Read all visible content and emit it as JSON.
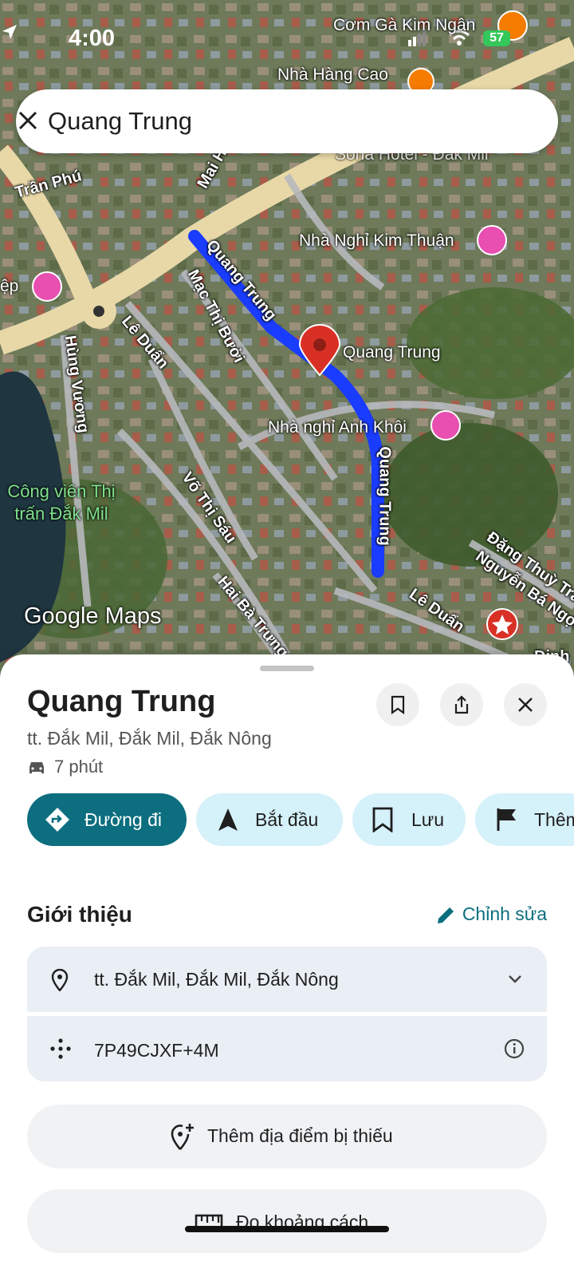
{
  "status_bar": {
    "time": "4:00",
    "battery": "57"
  },
  "search": {
    "value": "Quang Trung"
  },
  "map": {
    "labels": {
      "com_ga": "Cơm Gà Kim Ngân",
      "nha_hang": "Nhà Hàng Cao",
      "sona": "Sona Hotel - Đắk Mil",
      "tran_phu": "Trần Phú",
      "mai": "Mai H",
      "kim_thuan": "Nhà Nghỉ Kim Thuận",
      "ep": "ệp",
      "quang_trung_road": "Quang Trung",
      "mac_thi_buoi": "Mạc Thị Bưởi",
      "le_duan_1": "Lê Duẩn",
      "hung_vuong": "Hùng Vương",
      "pin_label": "Quang Trung",
      "anh_khoi": "Nhà nghỉ Anh Khôi",
      "quang_trung_road_2": "Quang Trung",
      "cong_vien": "Công viên Thị trấn Đắk Mil",
      "vo_thi_sau": "Võ Thị Sáu",
      "dang_thuy_tram": "Đặng Thuỳ Trâ",
      "nguyen_ba_ngoc": "Nguyễn Bá Ngọc",
      "hai_ba_trung": "Hai Bà Trưng",
      "le_duan_2": "Lê Duẩn",
      "dinh": "Đinh",
      "logo": "Google Maps"
    }
  },
  "place": {
    "title": "Quang Trung",
    "address": "tt. Đắk Mil, Đắk Mil, Đắk Nông",
    "eta": "7 phút"
  },
  "actions": {
    "directions": "Đường đi",
    "start": "Bắt đầu",
    "save": "Lưu",
    "more": "Thêm"
  },
  "intro": {
    "title": "Giới thiệu",
    "edit": "Chỉnh sửa",
    "address": "tt. Đắk Mil, Đắk Mil, Đắk Nông",
    "plus_code": "7P49CJXF+4M"
  },
  "buttons": {
    "add_missing": "Thêm địa điểm bị thiếu",
    "measure": "Đo khoảng cách"
  },
  "colors": {
    "route": "#1a3cff",
    "primary": "#0c6e7f",
    "chip": "#d5f1fa",
    "pin": "#d93025"
  }
}
